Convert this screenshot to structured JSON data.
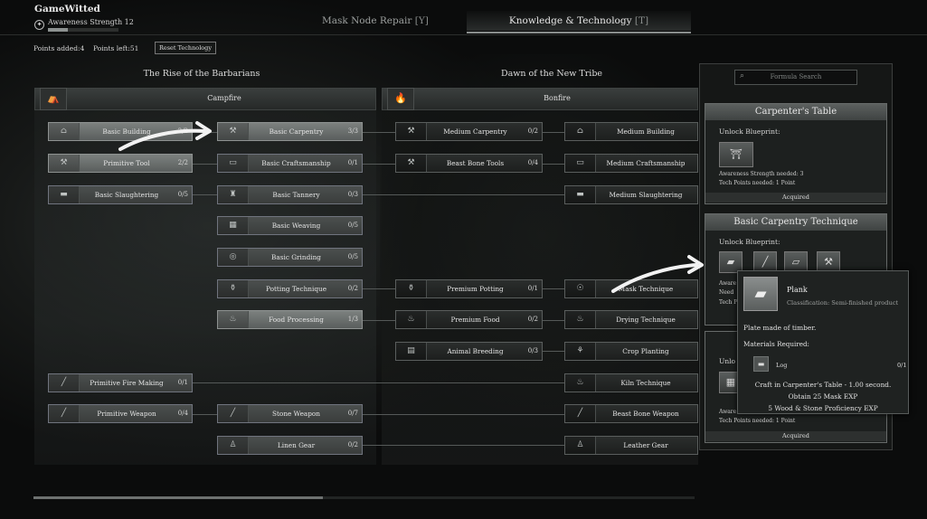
{
  "player": {
    "name": "GameWitted",
    "awareness": "Awareness Strength 12",
    "awareness_progress": 0.28
  },
  "tabs": [
    {
      "label": "Mask Node Repair",
      "key": "[Y]"
    },
    {
      "label": "Knowledge & Technology",
      "key": "[T]"
    }
  ],
  "points": {
    "added": "Points added:4",
    "left": "Points left:51"
  },
  "reset_label": "Reset Technology",
  "eras": [
    "The Rise of the Barbarians",
    "Dawn of the New Tribe"
  ],
  "branches": [
    "Campfire",
    "Bonfire"
  ],
  "nodes": {
    "basic_building": {
      "name": "Basic Building",
      "count": "2/2"
    },
    "primitive_tool": {
      "name": "Primitive Tool",
      "count": "2/2"
    },
    "basic_slaughtering": {
      "name": "Basic Slaughtering",
      "count": "0/5"
    },
    "primitive_fire_making": {
      "name": "Primitive Fire Making",
      "count": "0/1"
    },
    "primitive_weapon": {
      "name": "Primitive Weapon",
      "count": "0/4"
    },
    "basic_carpentry": {
      "name": "Basic Carpentry",
      "count": "3/3"
    },
    "basic_craftsmanship": {
      "name": "Basic Craftsmanship",
      "count": "0/1"
    },
    "basic_tannery": {
      "name": "Basic Tannery",
      "count": "0/3"
    },
    "basic_weaving": {
      "name": "Basic Weaving",
      "count": "0/5"
    },
    "basic_grinding": {
      "name": "Basic Grinding",
      "count": "0/5"
    },
    "potting_technique": {
      "name": "Potting Technique",
      "count": "0/2"
    },
    "food_processing": {
      "name": "Food Processing",
      "count": "1/3"
    },
    "stone_weapon": {
      "name": "Stone Weapon",
      "count": "0/7"
    },
    "linen_gear": {
      "name": "Linen Gear",
      "count": "0/2"
    },
    "medium_carpentry": {
      "name": "Medium Carpentry",
      "count": "0/2"
    },
    "beast_bone_tools": {
      "name": "Beast Bone Tools",
      "count": "0/4"
    },
    "premium_potting": {
      "name": "Premium Potting",
      "count": "0/1"
    },
    "premium_food": {
      "name": "Premium Food",
      "count": "0/2"
    },
    "animal_breeding": {
      "name": "Animal Breeding",
      "count": "0/3"
    },
    "medium_building": {
      "name": "Medium Building",
      "count": ""
    },
    "medium_craftsmanship": {
      "name": "Medium Craftsmanship",
      "count": ""
    },
    "medium_slaughtering": {
      "name": "Medium Slaughtering",
      "count": ""
    },
    "mask_technique": {
      "name": "Mask Technique",
      "count": ""
    },
    "drying_technique": {
      "name": "Drying Technique",
      "count": ""
    },
    "crop_planting": {
      "name": "Crop Planting",
      "count": ""
    },
    "kiln_technique": {
      "name": "Kiln Technique",
      "count": ""
    },
    "beast_bone_weapon": {
      "name": "Beast Bone Weapon",
      "count": ""
    },
    "leather_gear": {
      "name": "Leather Gear",
      "count": ""
    }
  },
  "panel": {
    "search_placeholder": "Formula Search",
    "card1": {
      "title": "Carpenter's Table",
      "unlock": "Unlock Blueprint:",
      "req1": "Awareness Strength needed: 3",
      "req2": "Tech Points needed: 1 Point",
      "status": "Acquired"
    },
    "card2": {
      "title": "Basic Carpentry Technique",
      "unlock": "Unlock Blueprint:",
      "req1_partial": "Aware",
      "req2_partial": "Need",
      "req3_partial": "Tech P"
    },
    "card3": {
      "unlock_partial": "Unlo",
      "req1_partial": "Aware",
      "req2": "Tech Points needed: 1 Point",
      "status": "Acquired"
    }
  },
  "tooltip": {
    "name": "Plank",
    "classification": "Classification: Semi-finished product",
    "description": "Plate made of timber.",
    "materials_label": "Materials Required:",
    "material": "Log",
    "material_count": "0/1",
    "craft": "Craft in Carpenter's Table - 1.00 second.",
    "exp": "Obtain 25 Mask EXP",
    "proficiency": "5 Wood & Stone Proficiency EXP"
  }
}
